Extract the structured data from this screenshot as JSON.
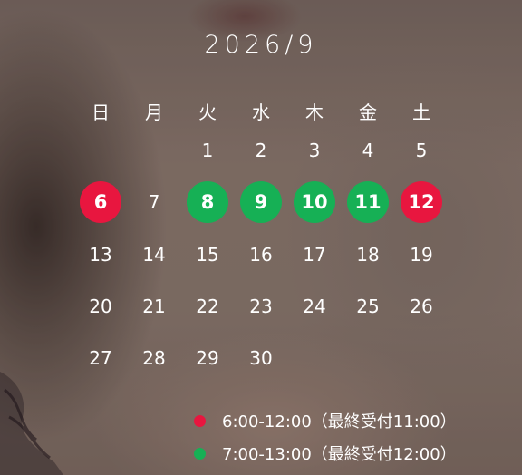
{
  "calendar": {
    "title": "2026/9",
    "weekdays": [
      "日",
      "月",
      "火",
      "水",
      "木",
      "金",
      "土"
    ],
    "weeks": [
      [
        null,
        null,
        1,
        2,
        3,
        4,
        5
      ],
      [
        6,
        7,
        8,
        9,
        10,
        11,
        12
      ],
      [
        13,
        14,
        15,
        16,
        17,
        18,
        19
      ],
      [
        20,
        21,
        22,
        23,
        24,
        25,
        26
      ],
      [
        27,
        28,
        29,
        30,
        null,
        null,
        null
      ]
    ],
    "highlight_red": [
      6,
      12
    ],
    "highlight_green": [
      8,
      9,
      10,
      11
    ]
  },
  "legend": [
    {
      "color": "#e8163f",
      "label": "6:00-12:00（最終受付11:00）"
    },
    {
      "color": "#16b055",
      "label": "7:00-13:00（最終受付12:00）"
    }
  ]
}
